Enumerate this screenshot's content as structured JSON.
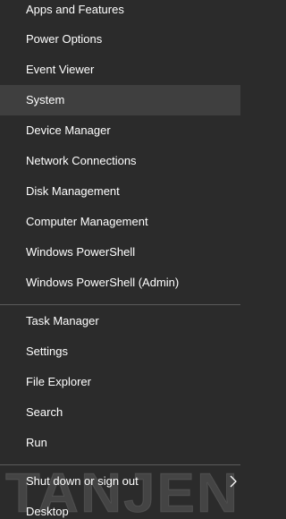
{
  "menu": {
    "items": [
      "Apps and Features",
      "Power Options",
      "Event Viewer",
      "System",
      "Device Manager",
      "Network Connections",
      "Disk Management",
      "Computer Management",
      "Windows PowerShell",
      "Windows PowerShell (Admin)",
      "Task Manager",
      "Settings",
      "File Explorer",
      "Search",
      "Run",
      "Shut down or sign out",
      "Desktop"
    ],
    "highlighted": "System",
    "submenu_icon": "chevron-right-icon"
  },
  "watermark": {
    "text": "TANJEN"
  },
  "colors": {
    "background": "#2b2b2b",
    "highlight": "#3f3f3f",
    "separator": "#5b5b5b",
    "text": "#ffffff"
  }
}
